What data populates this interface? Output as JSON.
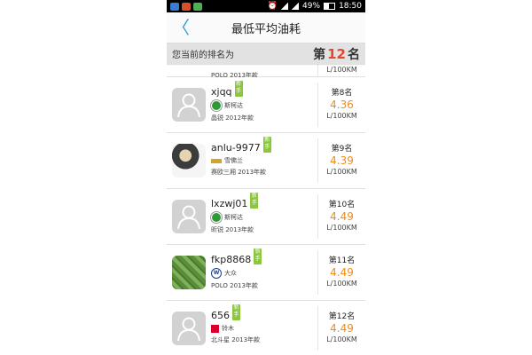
{
  "status_bar": {
    "battery_percent": "49%",
    "time": "18:50"
  },
  "header": {
    "title": "最低平均油耗",
    "back_label": "〈"
  },
  "my_rank": {
    "label": "您当前的排名为",
    "prefix": "第",
    "value": "12",
    "suffix": "名"
  },
  "partial_top": {
    "car_model": "POLO 2013年款",
    "unit": "L/100KM"
  },
  "entries": [
    {
      "username": "xjqq",
      "badge": "新手",
      "brand": "斯柯达",
      "brand_logo": "skoda-logo",
      "car_model": "晶锐 2012年款",
      "rank": "第8名",
      "value": "4.36",
      "unit": "L/100KM",
      "avatar": "default"
    },
    {
      "username": "anlu-9977",
      "badge": "新手",
      "brand": "雪佛兰",
      "brand_logo": "chevrolet-logo",
      "car_model": "赛欧三厢 2013年款",
      "rank": "第9名",
      "value": "4.39",
      "unit": "L/100KM",
      "avatar": "photo1"
    },
    {
      "username": "lxzwj01",
      "badge": "新手",
      "brand": "斯柯达",
      "brand_logo": "skoda-logo",
      "car_model": "昕锐 2013年款",
      "rank": "第10名",
      "value": "4.49",
      "unit": "L/100KM",
      "avatar": "default"
    },
    {
      "username": "fkp8868",
      "badge": "新手",
      "brand": "大众",
      "brand_logo": "volkswagen-logo",
      "car_model": "POLO 2013年款",
      "rank": "第11名",
      "value": "4.49",
      "unit": "L/100KM",
      "avatar": "photo2"
    },
    {
      "username": "656",
      "badge": "新手",
      "brand": "铃木",
      "brand_logo": "suzuki-logo",
      "car_model": "北斗星 2013年款",
      "rank": "第12名",
      "value": "4.49",
      "unit": "L/100KM",
      "avatar": "default"
    }
  ],
  "colors": {
    "accent": "#f08c1a",
    "rank_highlight": "#e8452b",
    "badge": "#8cc63f",
    "back": "#2aa0d6"
  }
}
